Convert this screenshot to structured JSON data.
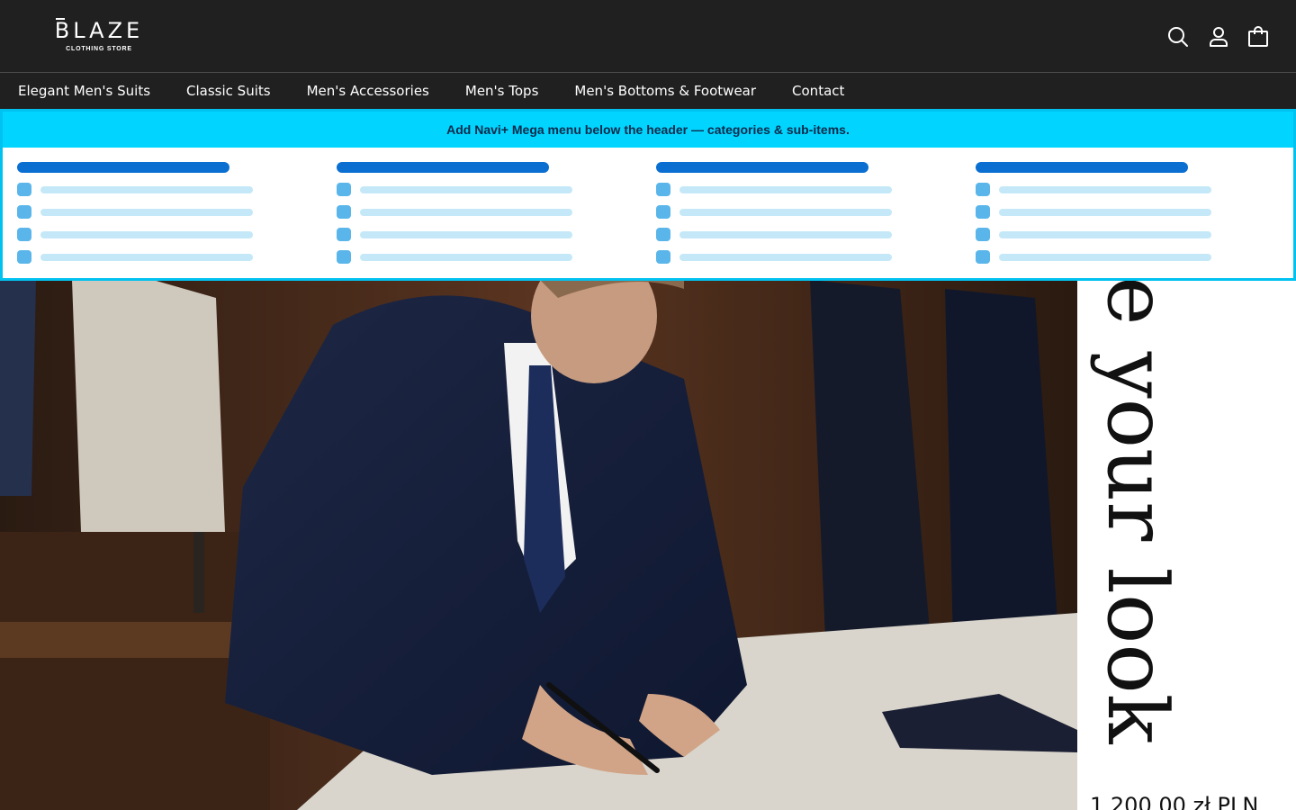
{
  "header": {
    "logo": {
      "word": "BLAZE",
      "subtitle": "CLOTHING STORE"
    },
    "icons": [
      "search-icon",
      "account-icon",
      "cart-icon"
    ]
  },
  "nav": {
    "items": [
      {
        "label": "Elegant Men's Suits"
      },
      {
        "label": "Classic Suits"
      },
      {
        "label": "Men's Accessories"
      },
      {
        "label": "Men's Tops"
      },
      {
        "label": "Men's Bottoms & Footwear"
      },
      {
        "label": "Contact"
      }
    ]
  },
  "mega_menu": {
    "banner": "Add Navi+ Mega menu below the header — categories & sub-items.",
    "columns": 4,
    "rows_per_column": 4
  },
  "hero": {
    "side_title": "e your look",
    "price": "1 200,00 zł PLN"
  },
  "colors": {
    "header_bg": "#202020",
    "mega_accent": "#00d4ff",
    "placeholder_head": "#0a6fd1",
    "placeholder_line": "#c4e8f8"
  }
}
